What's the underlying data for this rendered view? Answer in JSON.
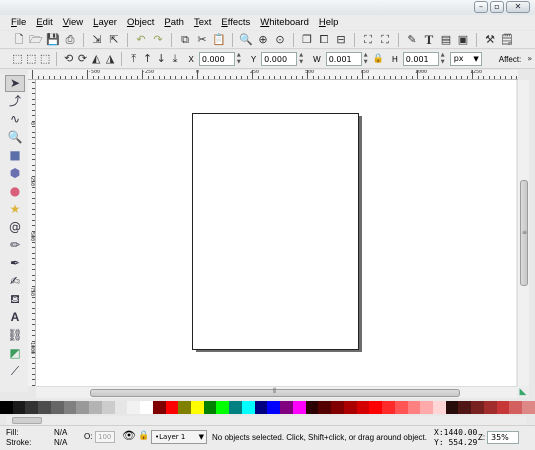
{
  "window": {
    "min_icon": "minimize-icon",
    "max_icon": "maximize-icon",
    "close_icon": "close-icon"
  },
  "menubar": [
    "File",
    "Edit",
    "View",
    "Layer",
    "Object",
    "Path",
    "Text",
    "Effects",
    "Whiteboard",
    "Help"
  ],
  "toolbar": {
    "icons": [
      "new-document-icon",
      "open-icon",
      "save-icon",
      "print-icon",
      "import-icon",
      "export-icon",
      "undo-icon",
      "redo-icon",
      "copy-icon",
      "cut-icon",
      "paste-icon",
      "zoom-selection-icon",
      "zoom-drawing-icon",
      "zoom-page-icon",
      "duplicate-icon",
      "clone-icon",
      "unlink-clone-icon",
      "group-icon",
      "ungroup-icon",
      "fill-stroke-icon",
      "text-font-icon",
      "layers-icon",
      "xml-editor-icon",
      "align-icon",
      "preferences-icon"
    ]
  },
  "controls": {
    "x_label": "X",
    "x_value": "0.000",
    "y_label": "Y",
    "y_value": "0.000",
    "w_label": "W",
    "w_value": "0.001",
    "h_label": "H",
    "h_value": "0.001",
    "unit": "px",
    "affect_label": "Affect:"
  },
  "ruler": {
    "h_labels": [
      "-500",
      "-250",
      "0",
      "250",
      "500",
      "750",
      "1000",
      "1250"
    ],
    "v_labels": [
      "0",
      "250",
      "500",
      "750",
      "1000"
    ]
  },
  "tools": [
    "selector-tool-icon",
    "node-tool-icon",
    "tweak-tool-icon",
    "zoom-tool-icon",
    "rectangle-tool-icon",
    "3d-box-tool-icon",
    "ellipse-tool-icon",
    "star-tool-icon",
    "spiral-tool-icon",
    "pencil-tool-icon",
    "pen-tool-icon",
    "calligraphy-tool-icon",
    "paint-bucket-tool-icon",
    "text-tool-icon",
    "connector-tool-icon",
    "gradient-tool-icon",
    "dropper-tool-icon"
  ],
  "palette": [
    "#000000",
    "#1a1a1a",
    "#333333",
    "#4d4d4d",
    "#666666",
    "#808080",
    "#999999",
    "#b3b3b3",
    "#cccccc",
    "#e6e6e6",
    "#f2f2f2",
    "#ffffff",
    "#800000",
    "#ff0000",
    "#808000",
    "#ffff00",
    "#008000",
    "#00ff00",
    "#008080",
    "#00ffff",
    "#000080",
    "#0000ff",
    "#800080",
    "#ff00ff",
    "#2b0000",
    "#550000",
    "#800000",
    "#aa0000",
    "#d40000",
    "#ff0000",
    "#ff2a2a",
    "#ff5555",
    "#ff8080",
    "#ffaaaa",
    "#ffd5d5",
    "#280b0b",
    "#501616",
    "#782121",
    "#a02c2c",
    "#c83737",
    "#d35f5f",
    "#de8787"
  ],
  "status": {
    "fill_label": "Fill:",
    "fill_value": "N/A",
    "stroke_label": "Stroke:",
    "stroke_value": "N/A",
    "opacity_label": "O:",
    "opacity_value": "100",
    "layer": "•Layer 1",
    "message": "No objects selected. Click, Shift+click, or drag around object.",
    "x_coord": "X:1440.00",
    "y_coord": "Y: 554.29",
    "zoom_label": "Z:",
    "zoom_value": "35%"
  }
}
